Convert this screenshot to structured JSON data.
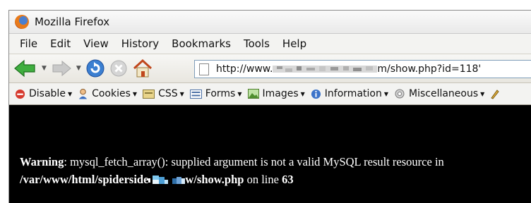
{
  "window": {
    "title": "Mozilla Firefox"
  },
  "menu": {
    "items": [
      "File",
      "Edit",
      "View",
      "History",
      "Bookmarks",
      "Tools",
      "Help"
    ]
  },
  "navigation": {
    "url_visible": "http://www.",
    "url_end": "m/show.php?id=118'"
  },
  "webdev_toolbar": {
    "items": [
      "Disable",
      "Cookies",
      "CSS",
      "Forms",
      "Images",
      "Information",
      "Miscellaneous"
    ]
  },
  "page": {
    "warning_label": "Warning",
    "warning_text": ": mysql_fetch_array(): supplied argument is not a valid MySQL result resource in",
    "path_start": "/var/www/html/spiderside",
    "path_end": "w/show.php",
    "line_text": " on line ",
    "line_number": "63"
  }
}
